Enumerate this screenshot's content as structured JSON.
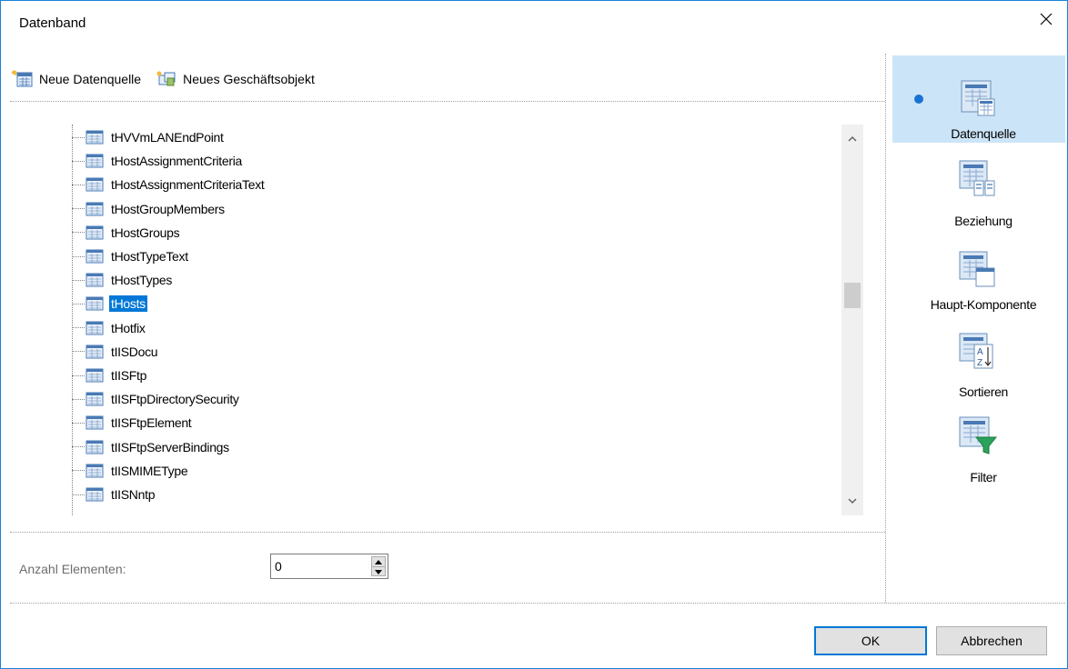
{
  "window": {
    "title": "Datenband",
    "close_icon": "close-icon"
  },
  "toolbar": {
    "new_datasource": {
      "label": "Neue Datenquelle",
      "icon": "datasource-add-icon"
    },
    "new_business_object": {
      "label": "Neues Geschäftsobjekt",
      "icon": "business-object-add-icon"
    }
  },
  "tree": {
    "item_icon": "table-icon",
    "items": [
      {
        "label": "tHVVmLANEndPoint"
      },
      {
        "label": "tHostAssignmentCriteria"
      },
      {
        "label": "tHostAssignmentCriteriaText"
      },
      {
        "label": "tHostGroupMembers"
      },
      {
        "label": "tHostGroups"
      },
      {
        "label": "tHostTypeText"
      },
      {
        "label": "tHostTypes"
      },
      {
        "label": "tHosts",
        "selected": true
      },
      {
        "label": "tHotfix"
      },
      {
        "label": "tIISDocu"
      },
      {
        "label": "tIISFtp"
      },
      {
        "label": "tIISFtpDirectorySecurity"
      },
      {
        "label": "tIISFtpElement"
      },
      {
        "label": "tIISFtpServerBindings"
      },
      {
        "label": "tIISMIMEType"
      },
      {
        "label": "tIISNntp"
      }
    ],
    "scroll_position": 0.42
  },
  "count": {
    "label": "Anzahl Elementen:",
    "value": "0"
  },
  "side_panel": {
    "items": [
      {
        "label": "Datenquelle",
        "icon": "datasource-icon",
        "active": true
      },
      {
        "label": "Beziehung",
        "icon": "relation-icon"
      },
      {
        "label": "Haupt-Komponente",
        "icon": "master-component-icon"
      },
      {
        "label": "Sortieren",
        "icon": "sort-icon"
      },
      {
        "label": "Filter",
        "icon": "filter-icon"
      }
    ]
  },
  "buttons": {
    "ok": "OK",
    "cancel": "Abbrechen"
  },
  "colors": {
    "accent": "#0078d7",
    "selection": "#0078d7",
    "active_panel": "#cce4f7",
    "window_border": "#1883d7"
  }
}
